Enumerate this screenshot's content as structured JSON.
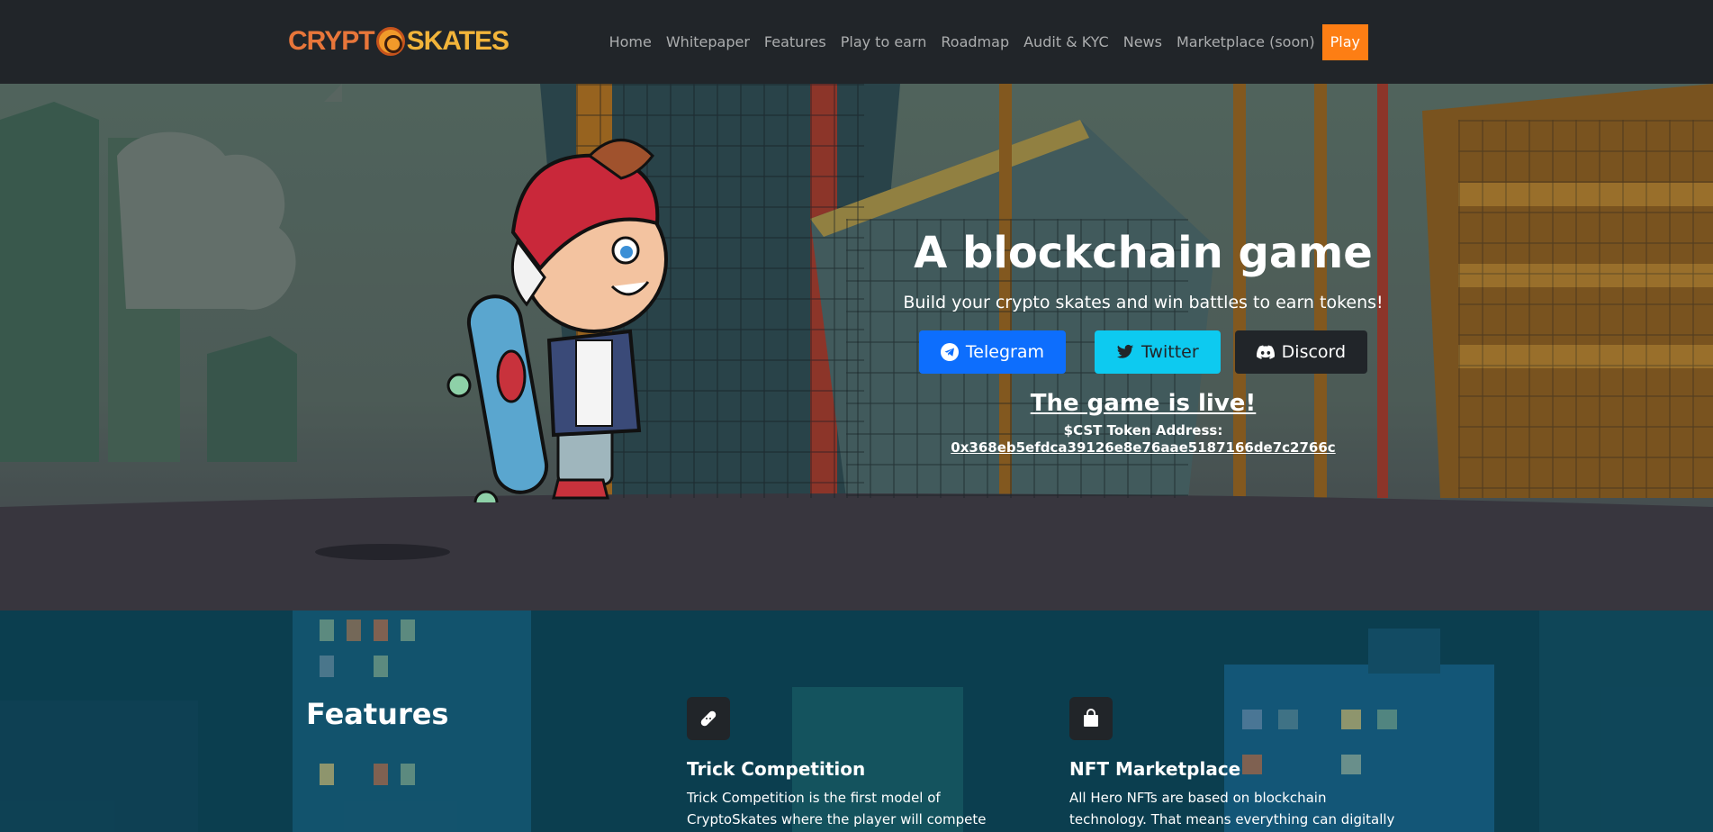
{
  "brand": {
    "part1": "CRYPT",
    "part2": "SKATES"
  },
  "nav": {
    "links": [
      "Home",
      "Whitepaper",
      "Features",
      "Play to earn",
      "Roadmap",
      "Audit & KYC",
      "News",
      "Marketplace (soon)"
    ],
    "play": "Play"
  },
  "hero": {
    "title": "A blockchain game",
    "subtitle": "Build your crypto skates and win battles to earn tokens!",
    "buttons": {
      "telegram": "Telegram",
      "twitter": "Twitter",
      "discord": "Discord"
    },
    "live": "The game is live!",
    "token_label": "$CST Token Address:",
    "token_address": "0x368eb5efdca39126e8e76aae5187166de7c2766c"
  },
  "features": {
    "title": "Features",
    "items": [
      {
        "icon": "bandage-icon",
        "title": "Trick Competition",
        "text": "Trick Competition is the first model of CryptoSkates where the player will compete against the other"
      },
      {
        "icon": "bag-icon",
        "title": "NFT Marketplace",
        "text": "All Hero NFTs are based on blockchain technology. That means everything can digitally own, transferred,"
      }
    ]
  },
  "colors": {
    "navbar": "#212529",
    "play": "#fd7e14",
    "telegram": "#0d6efd",
    "twitter": "#0dcaf0",
    "discord": "#212529",
    "features_bg": "#0f4a5c"
  }
}
